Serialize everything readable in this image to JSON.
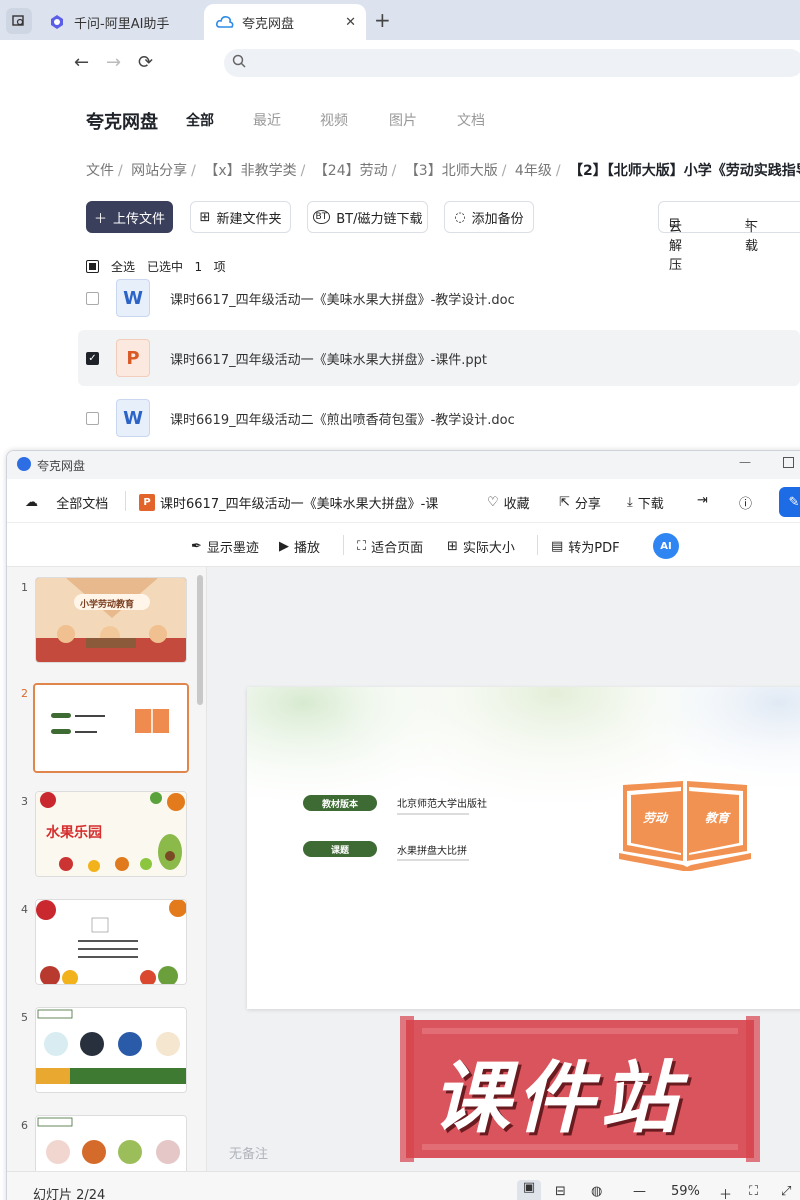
{
  "browser": {
    "tabs": [
      {
        "label": "千问-阿里AI助手",
        "icon": "qianwen-logo-icon"
      },
      {
        "label": "夸克网盘",
        "icon": "quark-cloud-icon"
      }
    ]
  },
  "pan": {
    "brand": "夸克网盘",
    "nav_tabs": [
      "全部",
      "最近",
      "视频",
      "图片",
      "文档"
    ],
    "breadcrumb": [
      "文件",
      "网站分享",
      "【x】非教学类",
      "【24】劳动",
      "【3】北师大版",
      "4年级"
    ],
    "breadcrumb_last": "【2】【北师大版】小学《劳动实践指导",
    "actions": {
      "upload": "上传文件",
      "new_folder": "新建文件夹",
      "bt": "BT/磁力链下载",
      "backup": "添加备份",
      "unzip": "云解压",
      "download": "下载"
    },
    "select_all": "全选",
    "selected_prefix": "已选中",
    "selected_count": "1",
    "selected_suffix": "项",
    "files": [
      {
        "name": "课时6617_四年级活动一《美味水果大拼盘》-教学设计.doc",
        "type": "W"
      },
      {
        "name": "课时6617_四年级活动一《美味水果大拼盘》-课件.ppt",
        "type": "P"
      },
      {
        "name": "课时6619_四年级活动二《煎出喷香荷包蛋》-教学设计.doc",
        "type": "W"
      }
    ]
  },
  "viewer": {
    "window_title": "夸克网盘",
    "all_docs": "全部文档",
    "doc_title": "课时6617_四年级活动一《美味水果大拼盘》-课",
    "collect": "收藏",
    "share": "分享",
    "download": "下载",
    "toolbar": {
      "ink": "显示墨迹",
      "play": "播放",
      "fit": "适合页面",
      "actual": "实际大小",
      "to_pdf": "转为PDF",
      "ai": "AI"
    },
    "thumbnails": [
      "1",
      "2",
      "3",
      "4",
      "5",
      "6"
    ],
    "thumb1_title": "小学劳动教育",
    "thumb3_title": "水果乐园",
    "slide": {
      "label1": "教材版本",
      "value1": "北京师范大学出版社",
      "label2": "课题",
      "value2": "水果拼盘大比拼",
      "book_left": "劳动",
      "book_right": "教育"
    },
    "no_notes": "无备注",
    "status": {
      "page": "幻灯片 2/24",
      "zoom": "59%"
    }
  },
  "watermark": "课件站"
}
